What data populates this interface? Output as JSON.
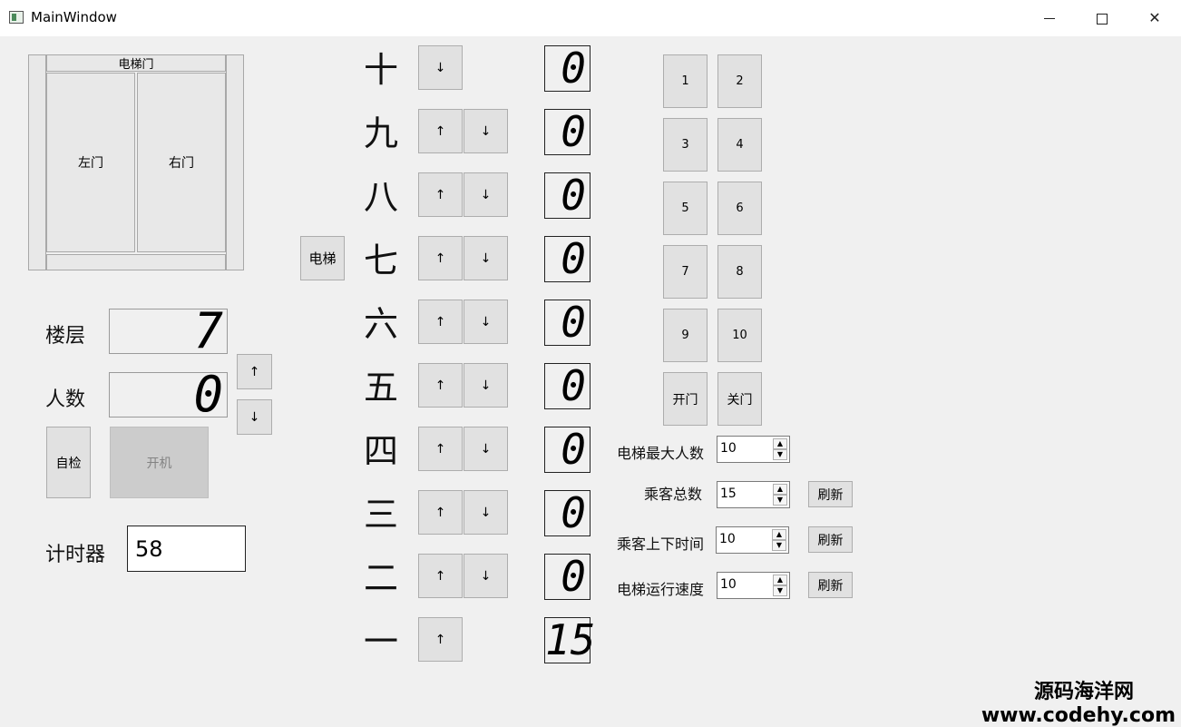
{
  "window": {
    "title": "MainWindow",
    "minimize": "—",
    "maximize": "□",
    "close": "✕"
  },
  "door": {
    "header": "电梯门",
    "left": "左门",
    "right": "右门"
  },
  "elevator_button": "电梯",
  "status": {
    "floor_label": "楼层",
    "floor_value": "7",
    "people_label": "人数",
    "people_value": "0",
    "up": "↑",
    "down": "↓",
    "self_check": "自检",
    "power_on": "开机",
    "timer_label": "计时器",
    "timer_value": "58"
  },
  "floors": [
    {
      "name": "十",
      "count": "0"
    },
    {
      "name": "九",
      "count": "0"
    },
    {
      "name": "八",
      "count": "0"
    },
    {
      "name": "七",
      "count": "0"
    },
    {
      "name": "六",
      "count": "0"
    },
    {
      "name": "五",
      "count": "0"
    },
    {
      "name": "四",
      "count": "0"
    },
    {
      "name": "三",
      "count": "0"
    },
    {
      "name": "二",
      "count": "0"
    },
    {
      "name": "一",
      "count": "15"
    }
  ],
  "arrows": {
    "up": "↑",
    "down": "↓"
  },
  "keypad": [
    "1",
    "2",
    "3",
    "4",
    "5",
    "6",
    "7",
    "8",
    "9",
    "10"
  ],
  "keypad_open": "开门",
  "keypad_close": "关门",
  "settings": {
    "max_people_label": "电梯最大人数",
    "max_people_value": "10",
    "total_label": "乘客总数",
    "total_value": "15",
    "board_time_label": "乘客上下时间",
    "board_time_value": "10",
    "speed_label": "电梯运行速度",
    "speed_value": "10",
    "refresh": "刷新",
    "spin_up": "▲",
    "spin_down": "▼"
  },
  "watermark": {
    "line1": "源码海洋网",
    "line2": "www.codehy.com"
  }
}
